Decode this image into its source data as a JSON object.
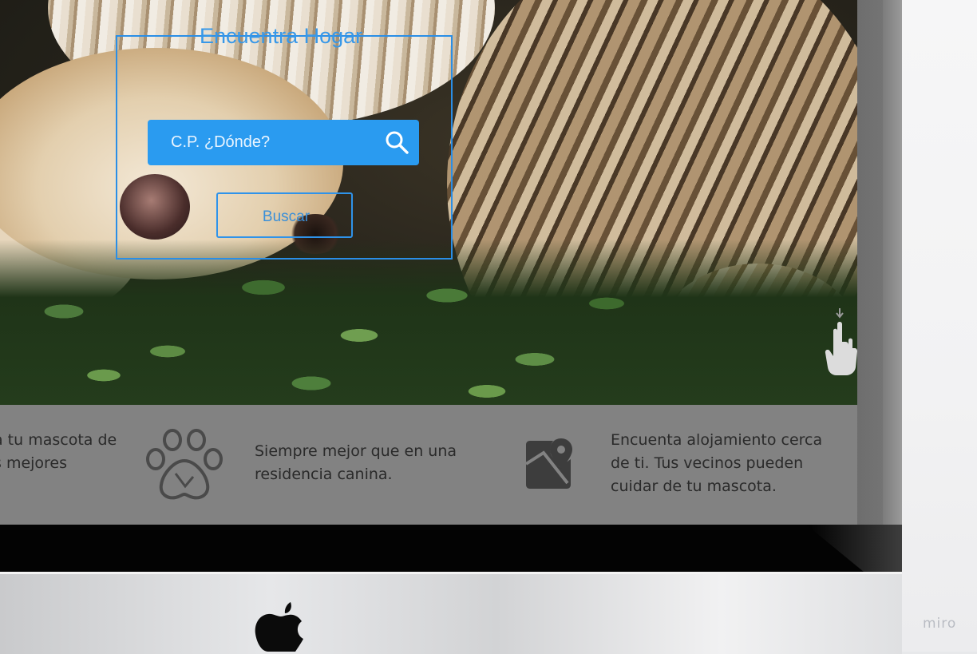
{
  "search": {
    "title": "Encuentra Hogar",
    "placeholder": "C.P. ¿Dónde?",
    "button_label": "Buscar"
  },
  "features": [
    {
      "text": "a tu mascota de s mejores",
      "icon": "paw-icon"
    },
    {
      "text": "Siempre mejor que en una residencia canina.",
      "icon": "paw-icon"
    },
    {
      "text": "Encuenta alojamiento cerca de ti. Tus vecinos pueden cuidar de tu mascota.",
      "icon": "map-pin-icon"
    }
  ],
  "brand": {
    "watermark": "miro"
  },
  "colors": {
    "accent": "#2a9bf0",
    "strip": "#828282",
    "text_dark": "#2a2a2a"
  },
  "icons": [
    "search-icon",
    "paw-icon",
    "map-pin-icon",
    "hand-cursor-icon",
    "apple-logo"
  ]
}
